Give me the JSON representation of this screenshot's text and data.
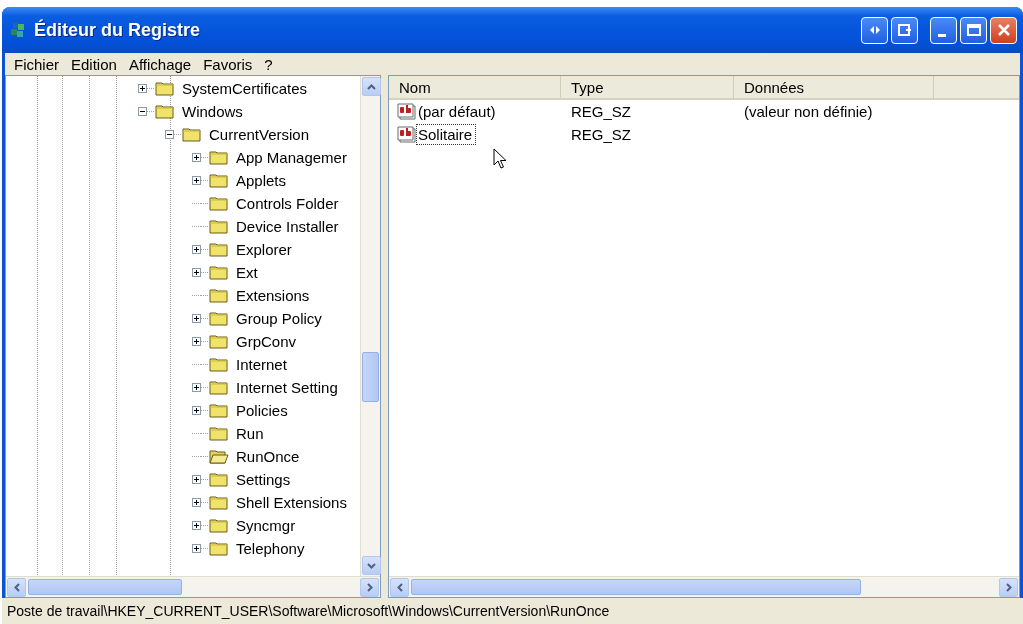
{
  "window": {
    "title": "Éditeur du Registre"
  },
  "menu": [
    "Fichier",
    "Edition",
    "Affichage",
    "Favoris",
    "?"
  ],
  "tree": [
    {
      "label": "SystemCertificates",
      "expanded": false,
      "selected": false
    },
    {
      "label": "Windows",
      "expanded": true,
      "selected": false,
      "children": [
        {
          "label": "CurrentVersion",
          "expanded": true,
          "selected": false,
          "children": [
            {
              "label": "App Managemer",
              "expanded": false,
              "selected": false
            },
            {
              "label": "Applets",
              "expanded": false,
              "selected": false
            },
            {
              "label": "Controls Folder",
              "selected": false
            },
            {
              "label": "Device Installer",
              "selected": false
            },
            {
              "label": "Explorer",
              "expanded": false,
              "selected": false
            },
            {
              "label": "Ext",
              "expanded": false,
              "selected": false
            },
            {
              "label": "Extensions",
              "selected": false
            },
            {
              "label": "Group Policy",
              "expanded": false,
              "selected": false
            },
            {
              "label": "GrpConv",
              "expanded": false,
              "selected": false
            },
            {
              "label": "Internet",
              "selected": false
            },
            {
              "label": "Internet Setting",
              "expanded": false,
              "selected": false
            },
            {
              "label": "Policies",
              "expanded": false,
              "selected": false
            },
            {
              "label": "Run",
              "selected": false
            },
            {
              "label": "RunOnce",
              "selected": true
            },
            {
              "label": "Settings",
              "expanded": false,
              "selected": false
            },
            {
              "label": "Shell Extensions",
              "expanded": false,
              "selected": false
            },
            {
              "label": "Syncmgr",
              "expanded": false,
              "selected": false
            },
            {
              "label": "Telephony",
              "expanded": false,
              "selected": false
            }
          ]
        }
      ]
    }
  ],
  "values": {
    "columns": [
      "Nom",
      "Type",
      "Données"
    ],
    "rows": [
      {
        "name": "(par défaut)",
        "type": "REG_SZ",
        "data": "(valeur non définie)",
        "selected": false
      },
      {
        "name": "Solitaire",
        "type": "REG_SZ",
        "data": "",
        "selected": true
      }
    ]
  },
  "status_bar": "Poste de travail\\HKEY_CURRENT_USER\\Software\\Microsoft\\Windows\\CurrentVersion\\RunOnce"
}
